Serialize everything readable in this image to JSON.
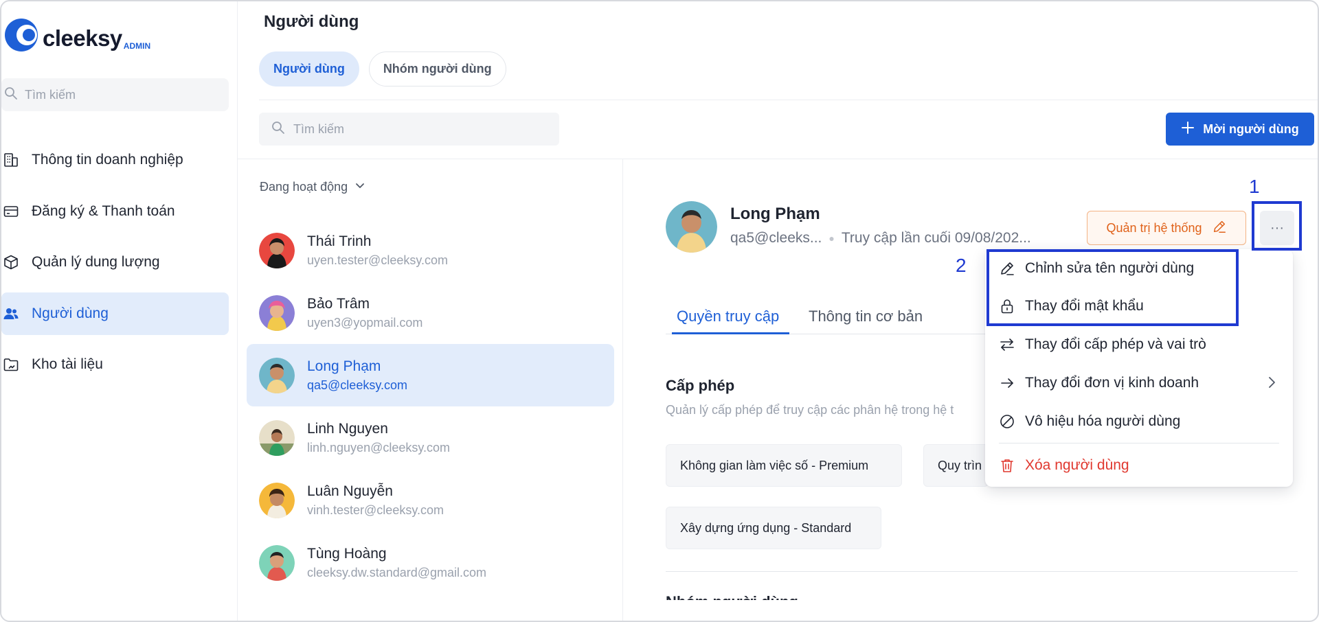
{
  "brand": {
    "name": "cleeksy",
    "sub": "ADMIN",
    "accent": "#1e5fd6"
  },
  "sidebar": {
    "search_placeholder": "Tìm kiếm",
    "items": [
      {
        "label": "Thông tin doanh nghiệp",
        "icon": "building-icon"
      },
      {
        "label": "Đăng ký & Thanh toán",
        "icon": "credit-card-icon"
      },
      {
        "label": "Quản lý dung lượng",
        "icon": "box-icon"
      },
      {
        "label": "Người dùng",
        "icon": "users-icon",
        "active": true
      },
      {
        "label": "Kho tài liệu",
        "icon": "folder-icon"
      }
    ]
  },
  "main": {
    "title": "Người dùng",
    "tabs": [
      {
        "label": "Người dùng",
        "active": true
      },
      {
        "label": "Nhóm người dùng"
      }
    ],
    "search_placeholder": "Tìm kiếm",
    "invite_label": "Mời người dùng"
  },
  "list": {
    "filter_label": "Đang hoạt động",
    "users": [
      {
        "name": "Thái Trinh",
        "email": "uyen.tester@cleeksy.com"
      },
      {
        "name": "Bảo Trâm",
        "email": "uyen3@yopmail.com"
      },
      {
        "name": "Long Phạm",
        "email": "qa5@cleeksy.com",
        "active": true
      },
      {
        "name": "Linh Nguyen",
        "email": "linh.nguyen@cleeksy.com"
      },
      {
        "name": "Luân Nguyễn",
        "email": "vinh.tester@cleeksy.com"
      },
      {
        "name": "Tùng Hoàng",
        "email": "cleeksy.dw.standard@gmail.com"
      }
    ]
  },
  "detail": {
    "name": "Long Phạm",
    "email_short": "qa5@cleeks...",
    "last_access": "Truy cập lần cuối 09/08/202...",
    "admin_label": "Quản trị hệ thống",
    "more_label": "···",
    "tabs": [
      {
        "label": "Quyền truy cập",
        "active": true
      },
      {
        "label": "Thông tin cơ bản"
      }
    ],
    "permissions": {
      "title": "Cấp phép",
      "description": "Quản lý cấp phép để truy cập các phân hệ trong hệ t",
      "chips": [
        "Không gian làm việc số - Premium",
        "Quy trìn",
        "Xây dựng ứng dụng - Standard"
      ]
    },
    "next_section_cut": "Nhóm người dùng"
  },
  "menu": {
    "items": [
      {
        "label": "Chỉnh sửa tên người dùng",
        "icon": "pencil-icon"
      },
      {
        "label": "Thay đổi mật khẩu",
        "icon": "lock-icon"
      },
      {
        "label": "Thay đổi cấp phép và vai trò",
        "icon": "swap-icon"
      },
      {
        "label": "Thay đổi đơn vị kinh doanh",
        "icon": "arrow-right-icon"
      },
      {
        "label": "Vô hiệu hóa người dùng",
        "icon": "ban-icon"
      },
      {
        "label": "Xóa người dùng",
        "icon": "trash-icon",
        "danger": true
      }
    ]
  },
  "annotations": {
    "label_1": "1",
    "label_2": "2",
    "color": "#1f3ad1"
  }
}
